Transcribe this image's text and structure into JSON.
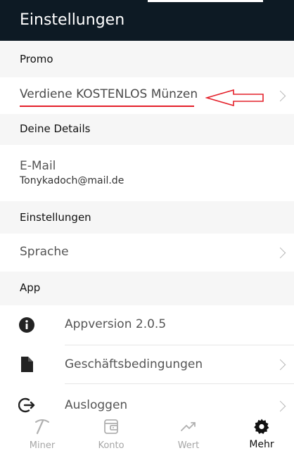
{
  "header": {
    "title": "Einstellungen"
  },
  "sections": {
    "promo": "Promo",
    "details": "Deine Details",
    "settings": "Einstellungen",
    "app": "App"
  },
  "promo": {
    "earn_coins_label": "Verdiene KOSTENLOS Münzen"
  },
  "details": {
    "email_label": "E-Mail",
    "email_value": "Tonykadoch@mail.de"
  },
  "settings": {
    "language_label": "Sprache"
  },
  "app": {
    "version_label": "Appversion 2.0.5",
    "terms_label": "Geschäftsbedingungen",
    "logout_label": "Ausloggen"
  },
  "icons": {
    "version": "info-icon",
    "terms": "document-icon",
    "logout": "logout-icon",
    "chevron": "chevron-right-icon"
  },
  "bottom_nav": {
    "items": [
      {
        "label": "Miner",
        "icon": "pickaxe-icon",
        "active": false
      },
      {
        "label": "Konto",
        "icon": "wallet-icon",
        "active": false
      },
      {
        "label": "Wert",
        "icon": "trending-up-icon",
        "active": false
      },
      {
        "label": "Mehr",
        "icon": "gear-icon",
        "active": true
      }
    ]
  },
  "colors": {
    "header_bg": "#0d1a24",
    "annotation_red": "#e4202a",
    "section_bg": "#f6f6f6",
    "active_nav": "#111111",
    "inactive_nav": "#a6a6a6"
  }
}
